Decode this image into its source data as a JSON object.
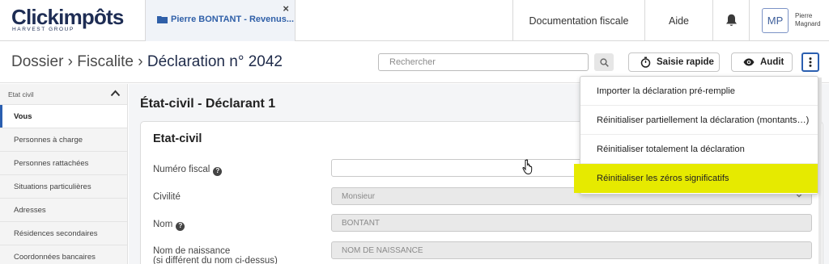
{
  "app": {
    "logo": "Clickimpôts",
    "logo_sub": "HARVEST GROUP"
  },
  "tab": {
    "label": "Pierre BONTANT - Revenus...",
    "close": "×"
  },
  "nav": {
    "documentation": "Documentation fiscale",
    "aide": "Aide"
  },
  "user": {
    "initials": "MP",
    "first_name": "Pierre",
    "last_name": "Magnard"
  },
  "breadcrumb": {
    "part1": "Dossier",
    "sep": " › ",
    "part2": "Fiscalite",
    "current": "Déclaration n° 2042"
  },
  "search": {
    "placeholder": "Rechercher"
  },
  "toolbar": {
    "saisie_label": "Saisie rapide",
    "audit_label": "Audit"
  },
  "sidebar": {
    "section": "Etat civil",
    "items": [
      {
        "label": "Vous",
        "active": true
      },
      {
        "label": "Personnes à charge"
      },
      {
        "label": "Personnes rattachées"
      },
      {
        "label": "Situations particulières"
      },
      {
        "label": "Adresses"
      },
      {
        "label": "Résidences secondaires"
      },
      {
        "label": "Coordonnées bancaires"
      }
    ]
  },
  "main": {
    "title": "État-civil - Déclarant 1",
    "card_title": "Etat-civil",
    "fields": {
      "numero_fiscal": {
        "label": "Numéro fiscal",
        "value": ""
      },
      "civilite": {
        "label": "Civilité",
        "value": "Monsieur"
      },
      "nom": {
        "label": "Nom",
        "value": "BONTANT"
      },
      "nom_naissance": {
        "label": "Nom de naissance",
        "label2": "(si différent du nom ci-dessus)",
        "placeholder": "NOM DE NAISSANCE"
      }
    }
  },
  "menu": {
    "items": [
      {
        "label": "Importer la déclaration pré-remplie"
      },
      {
        "label": "Réinitialiser partiellement la déclaration (montants…)"
      },
      {
        "label": "Réinitialiser totalement la déclaration"
      },
      {
        "label": "Réinitialiser les zéros significatifs",
        "highlighted": true
      }
    ]
  },
  "colors": {
    "brand": "#1e2d54",
    "accent": "#2b5fb0",
    "highlight": "#e6ea00"
  }
}
